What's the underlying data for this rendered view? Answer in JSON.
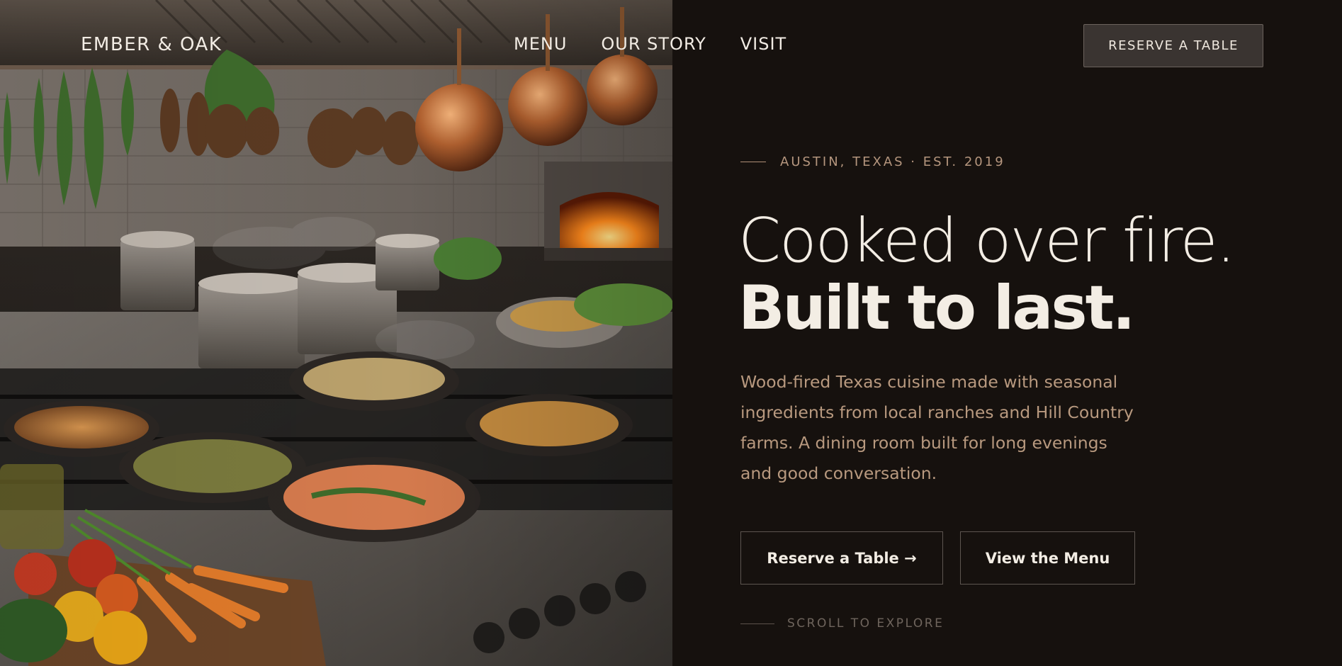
{
  "brand": {
    "name": "EMBER & OAK"
  },
  "nav": {
    "items": [
      "MENU",
      "OUR STORY",
      "VISIT"
    ],
    "cta": "RESERVE A TABLE"
  },
  "hero": {
    "eyebrow": "AUSTIN, TEXAS · EST. 2019",
    "headline_line1": "Cooked over fire.",
    "headline_line2": "Built to last.",
    "lede": "Wood-fired Texas cuisine made with seasonal ingredients from local ranches and Hill Country farms. A dining room built for long evenings and good conversation.",
    "primary_button": "Reserve a Table →",
    "secondary_button": "View the Menu",
    "scroll_cue": "SCROLL TO EXPLORE"
  },
  "colors": {
    "background": "#16110e",
    "text_primary": "#f3ede4",
    "accent_warm": "#b8997f",
    "muted": "#6f655d"
  }
}
